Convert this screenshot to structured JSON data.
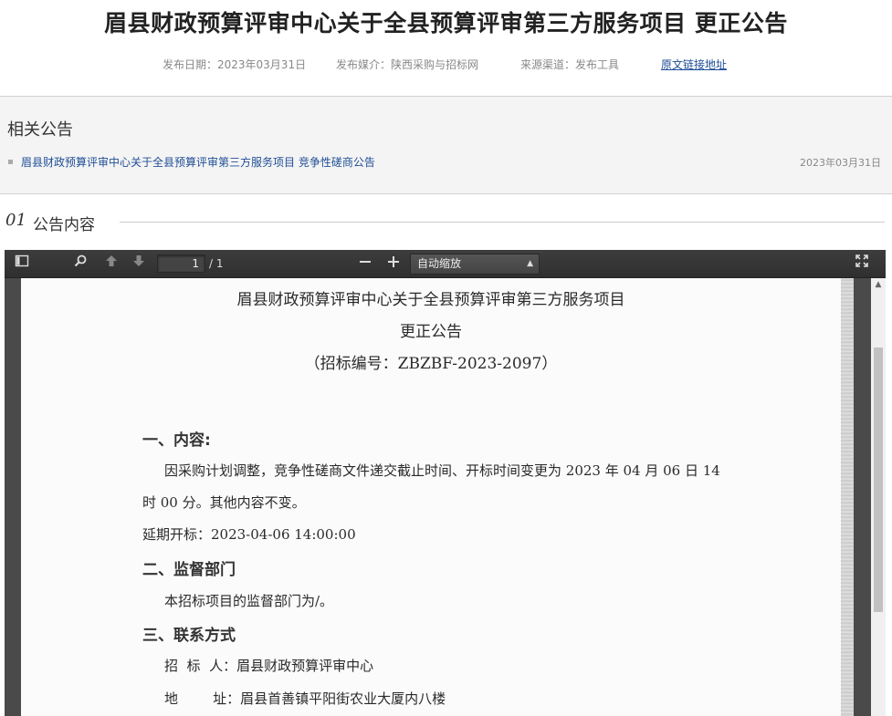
{
  "article": {
    "title": "眉县财政预算评审中心关于全县预算评审第三方服务项目 更正公告",
    "publish_date": "发布日期：2023年03月31日",
    "publish_media": "发布媒介：陕西采购与招标网",
    "source": "来源渠道：发布工具",
    "original_link": "原文链接地址"
  },
  "related": {
    "title": "相关公告",
    "items": [
      {
        "label": "眉县财政预算评审中心关于全县预算评审第三方服务项目 竞争性磋商公告",
        "date": "2023年03月31日"
      }
    ]
  },
  "section": {
    "number": "01",
    "title": "公告内容"
  },
  "pdf_viewer": {
    "page_current": "1",
    "page_total": "/ 1",
    "zoom": "自动缩放",
    "icons": {
      "sidebar": "sidebar-toggle-icon",
      "search": "search-icon",
      "prev": "arrow-up-icon",
      "next": "arrow-down-icon",
      "zoom_out": "minus-icon",
      "zoom_in": "plus-icon",
      "fullscreen": "fullscreen-icon"
    }
  },
  "document": {
    "line1": "眉县财政预算评审中心关于全县预算评审第三方服务项目",
    "line2": "更正公告",
    "line3": "（招标编号：ZBZBF-2023-2097）",
    "h1": "一、内容:",
    "p1a": "因采购计划调整，竞争性磋商文件递交截止时间、开标时间变更为 2023 年 04 月 06 日 14",
    "p1b": "时 00 分。其他内容不变。",
    "p1c": "延期开标：2023-04-06 14:00:00",
    "h2": "二、监督部门",
    "p2": "本招标项目的监督部门为/。",
    "h3": "三、联系方式",
    "p3a": "招  标  人：眉县财政预算评审中心",
    "p3b": "地        址：眉县首善镇平阳街农业大厦内八楼"
  }
}
